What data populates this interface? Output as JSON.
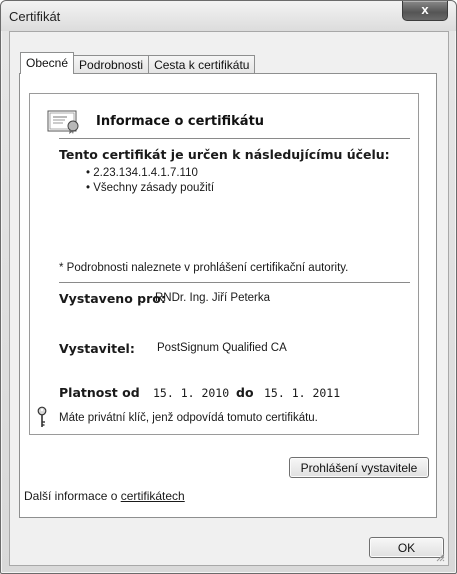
{
  "window": {
    "title": "Certifikát",
    "close_glyph": "x"
  },
  "tabs": [
    {
      "label": "Obecné",
      "active": true
    },
    {
      "label": "Podrobnosti",
      "active": false
    },
    {
      "label": "Cesta k certifikátu",
      "active": false
    }
  ],
  "certificate": {
    "icon": "certificate-icon",
    "info_title": "Informace o certifikátu",
    "purpose_heading": "Tento certifikát je určen k následujícímu účelu:",
    "purposes": [
      "2.23.134.1.4.1.7.110",
      "Všechny zásady použití"
    ],
    "note": "* Podrobnosti naleznete v prohlášení certifikační autority.",
    "issued_to_label": "Vystaveno pro:",
    "issued_to_value": "RNDr. Ing. Jiří Peterka",
    "issuer_label": "Vystavitel:",
    "issuer_value": "PostSignum Qualified CA",
    "valid_from_label": "Platnost od",
    "valid_from_value": "15. 1. 2010",
    "valid_to_label": "do",
    "valid_to_value": "15. 1. 2011",
    "key_icon": "key-icon",
    "private_key_note": "Máte privátní klíč, jenž odpovídá tomuto certifikátu."
  },
  "buttons": {
    "issuer_statement": "Prohlášení vystavitele",
    "ok": "OK"
  },
  "more_info": {
    "prefix": "Další informace o ",
    "link": "certifikátech"
  }
}
